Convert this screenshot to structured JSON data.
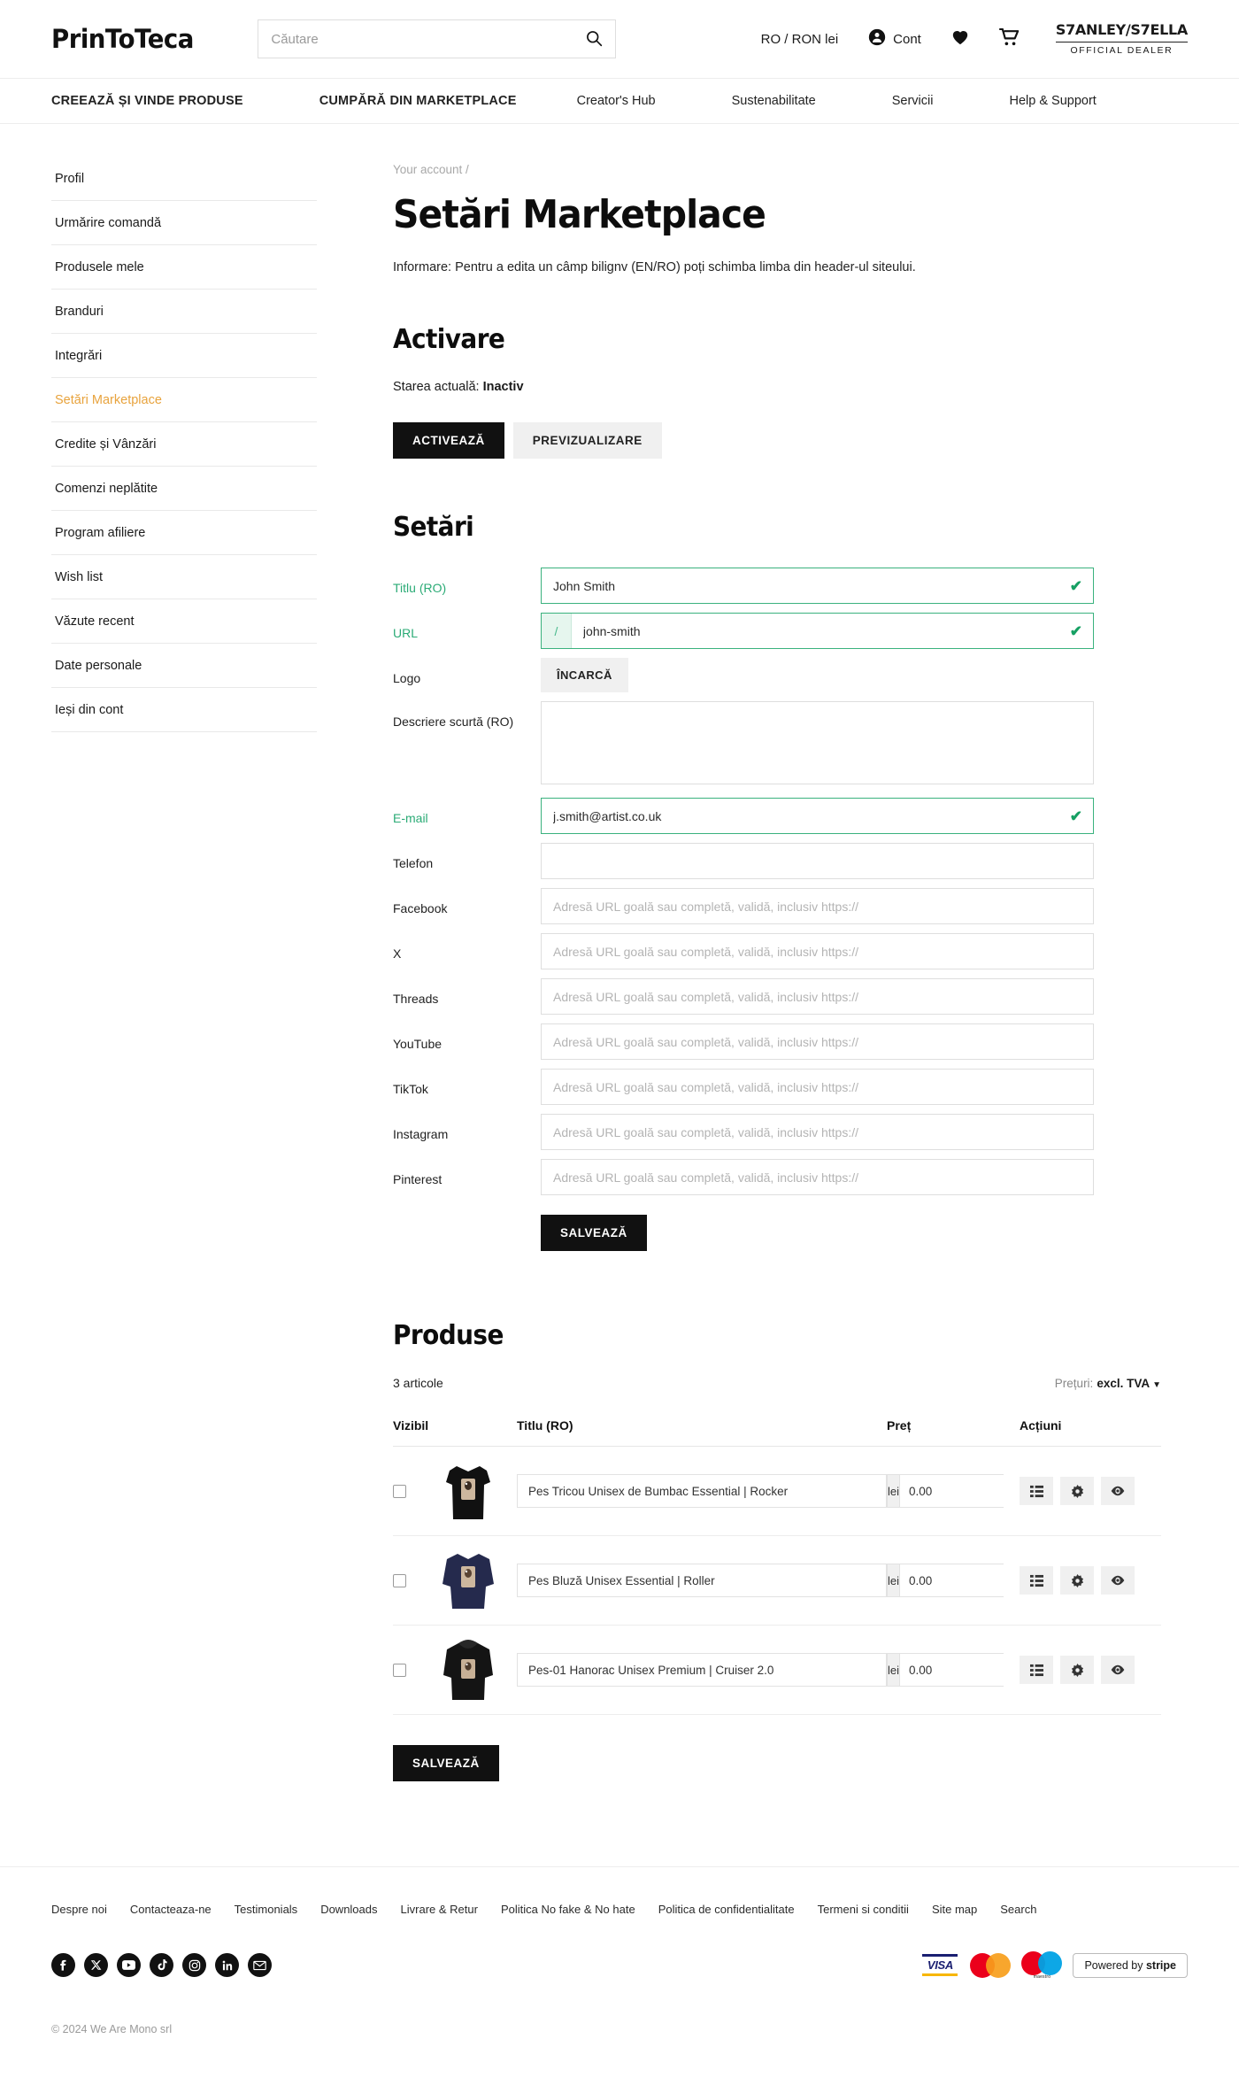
{
  "header": {
    "logo": "PrinToTeca",
    "search_placeholder": "Căutare",
    "search_value": "",
    "search_icon": "search-icon",
    "currency": "RO / RON lei",
    "account_label": "Cont",
    "account_icon": "account-icon",
    "wishlist_icon": "heart-icon",
    "cart_icon": "cart-icon",
    "dealer_badge_top": "S7ANLEY/S7ELLA",
    "dealer_badge_bottom": "OFFICIAL DEALER"
  },
  "nav": [
    {
      "label": "CREEAZĂ ȘI VINDE PRODUSE",
      "strong": true
    },
    {
      "label": "CUMPĂRĂ DIN MARKETPLACE",
      "strong": true
    },
    {
      "label": "Creator's Hub",
      "strong": false
    },
    {
      "label": "Sustenabilitate",
      "strong": false
    },
    {
      "label": "Servicii",
      "strong": false
    },
    {
      "label": "Help & Support",
      "strong": false
    }
  ],
  "sidebar": {
    "items": [
      {
        "label": "Profil",
        "active": false
      },
      {
        "label": "Urmărire comandă",
        "active": false
      },
      {
        "label": "Produsele mele",
        "active": false
      },
      {
        "label": "Branduri",
        "active": false
      },
      {
        "label": "Integrări",
        "active": false
      },
      {
        "label": "Setări Marketplace",
        "active": true
      },
      {
        "label": "Credite și Vânzări",
        "active": false
      },
      {
        "label": "Comenzi neplătite",
        "active": false
      },
      {
        "label": "Program afiliere",
        "active": false
      },
      {
        "label": "Wish list",
        "active": false
      },
      {
        "label": "Văzute recent",
        "active": false
      },
      {
        "label": "Date personale",
        "active": false
      },
      {
        "label": "Ieși din cont",
        "active": false
      }
    ],
    "active_color": "#e8a33d"
  },
  "main": {
    "breadcrumb": "Your account /",
    "title": "Setări Marketplace",
    "info": "Informare: Pentru a edita un câmp bilignv (EN/RO) poți schimba limba din header-ul siteului.",
    "activare": {
      "heading": "Activare",
      "state_prefix": "Starea actuală:",
      "state_value": "Inactiv",
      "activate_button": "ACTIVEAZĂ",
      "preview_button": "PREVIZUALIZARE"
    },
    "setari": {
      "heading": "Setări",
      "fields": [
        {
          "label": "Titlu (RO)",
          "value": "John Smith",
          "placeholder": "",
          "valid": true,
          "type": "text"
        },
        {
          "label": "URL",
          "value": "john-smith",
          "placeholder": "",
          "valid": true,
          "type": "url",
          "prefix": "/"
        },
        {
          "label": "Logo",
          "value": "",
          "placeholder": "",
          "valid": false,
          "type": "upload",
          "upload_label": "ÎNCARCĂ"
        },
        {
          "label": "Descriere scurtă (RO)",
          "value": "",
          "placeholder": "",
          "valid": false,
          "type": "textarea"
        },
        {
          "label": "E-mail",
          "value": "j.smith@artist.co.uk",
          "placeholder": "",
          "valid": true,
          "type": "text"
        },
        {
          "label": "Telefon",
          "value": "",
          "placeholder": "",
          "valid": false,
          "type": "text"
        },
        {
          "label": "Facebook",
          "value": "",
          "placeholder": "Adresă URL goală sau completă, validă, inclusiv https://",
          "valid": false,
          "type": "text"
        },
        {
          "label": "X",
          "value": "",
          "placeholder": "Adresă URL goală sau completă, validă, inclusiv https://",
          "valid": false,
          "type": "text"
        },
        {
          "label": "Threads",
          "value": "",
          "placeholder": "Adresă URL goală sau completă, validă, inclusiv https://",
          "valid": false,
          "type": "text"
        },
        {
          "label": "YouTube",
          "value": "",
          "placeholder": "Adresă URL goală sau completă, validă, inclusiv https://",
          "valid": false,
          "type": "text"
        },
        {
          "label": "TikTok",
          "value": "",
          "placeholder": "Adresă URL goală sau completă, validă, inclusiv https://",
          "valid": false,
          "type": "text"
        },
        {
          "label": "Instagram",
          "value": "",
          "placeholder": "Adresă URL goală sau completă, validă, inclusiv https://",
          "valid": false,
          "type": "text"
        },
        {
          "label": "Pinterest",
          "value": "",
          "placeholder": "Adresă URL goală sau completă, validă, inclusiv https://",
          "valid": false,
          "type": "text"
        }
      ],
      "save_button": "SALVEAZĂ"
    },
    "produse": {
      "heading": "Produse",
      "count_label": "3 articole",
      "price_mode_label": "Prețuri:",
      "price_mode_value": "excl. TVA",
      "columns": [
        "Vizibil",
        "Titlu (RO)",
        "Preț",
        "Acțiuni"
      ],
      "rows": [
        {
          "visible": false,
          "title": "Pes Tricou Unisex de Bumbac Essential | Rocker",
          "currency": "lei",
          "price": "0.00",
          "thumb": "tshirt-black"
        },
        {
          "visible": false,
          "title": "Pes Bluză Unisex Essential | Roller",
          "currency": "lei",
          "price": "0.00",
          "thumb": "sweater-navy"
        },
        {
          "visible": false,
          "title": "Pes-01 Hanorac Unisex Premium | Cruiser 2.0",
          "currency": "lei",
          "price": "0.00",
          "thumb": "hoodie-black"
        }
      ],
      "action_icons": [
        "list-icon",
        "gear-icon",
        "eye-icon"
      ],
      "save_button": "SALVEAZĂ"
    }
  },
  "footer": {
    "links": [
      "Despre noi",
      "Contacteaza-ne",
      "Testimonials",
      "Downloads",
      "Livrare & Retur",
      "Politica No fake & No hate",
      "Politica de confidentialitate",
      "Termeni si conditii",
      "Site map",
      "Search"
    ],
    "social": [
      "facebook-icon",
      "x-icon",
      "youtube-icon",
      "tiktok-icon",
      "instagram-icon",
      "linkedin-icon",
      "email-icon"
    ],
    "payments": [
      "visa-logo",
      "mastercard-logo",
      "maestro-logo",
      "stripe-badge"
    ],
    "visa_text": "VISA",
    "maestro_text": "maestro",
    "stripe_prefix": "Powered by",
    "stripe_name": "stripe",
    "copyright": "© 2024 We Are Mono srl"
  }
}
